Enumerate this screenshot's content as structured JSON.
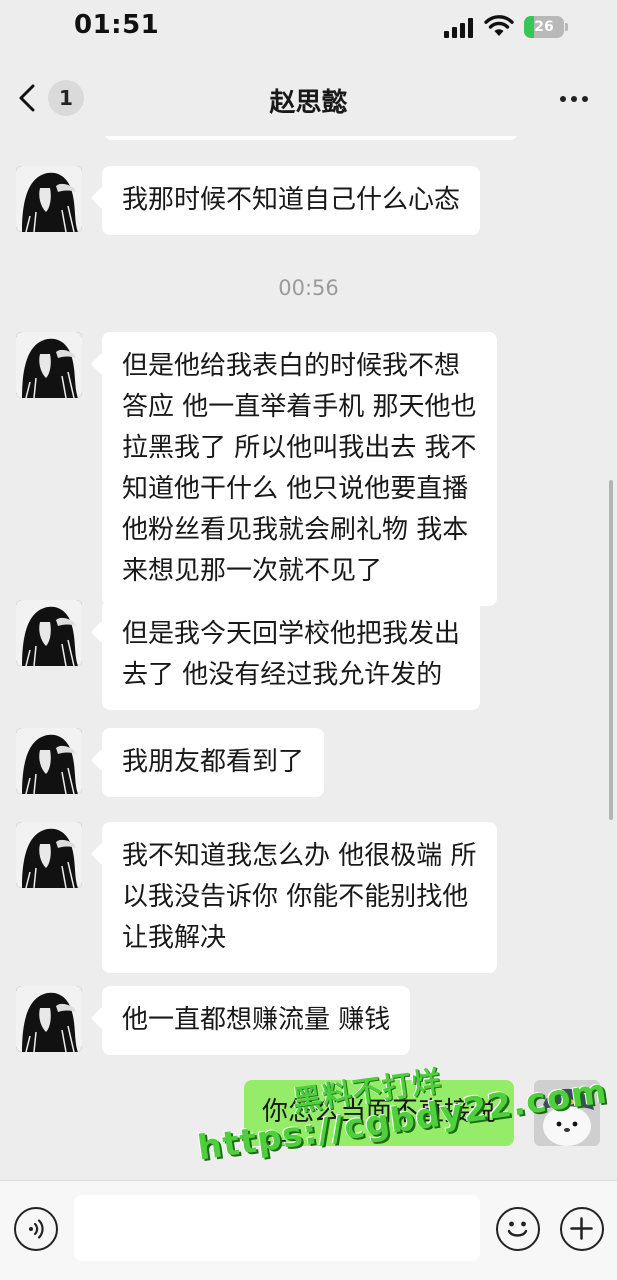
{
  "status_bar": {
    "time": "01:51",
    "battery_level": "26",
    "battery_fill_fraction": 0.26,
    "battery_color": "#34c759",
    "signal_icon": "cellular-signal-icon",
    "wifi_icon": "wifi-icon"
  },
  "nav": {
    "back_icon": "chevron-left-icon",
    "unread_count": "1",
    "title": "赵思懿",
    "more_icon": "more-dots-icon"
  },
  "messages": [
    {
      "sender": "contact",
      "text": "我那时候不知道自己什么心态"
    },
    {
      "type": "timestamp",
      "text": "00:56"
    },
    {
      "sender": "contact",
      "text": "但是他给我表白的时候我不想\n答应 他一直举着手机 那天他也\n拉黑我了 所以他叫我出去 我不\n知道他干什么 他只说他要直播\n他粉丝看见我就会刷礼物 我本\n来想见那一次就不见了"
    },
    {
      "sender": "contact",
      "text": "但是我今天回学校他把我发出\n去了 他没有经过我允许发的"
    },
    {
      "sender": "contact",
      "text": "我朋友都看到了"
    },
    {
      "sender": "contact",
      "text": "我不知道我怎么办 他很极端 所\n以我没告诉你 你能不能别找他\n让我解决"
    },
    {
      "sender": "contact",
      "text": "他一直都想赚流量 赚钱"
    },
    {
      "sender": "me",
      "text": "你怎么当面不直接说呢"
    }
  ],
  "watermark": {
    "line1": "黑料不打烊",
    "line2": "https://cgbdy22.com",
    "color": "#4fcf3c"
  },
  "input_bar": {
    "voice_icon": "voice-input-icon",
    "emoji_icon": "emoji-icon",
    "add_icon": "plus-circle-icon",
    "placeholder": ""
  },
  "colors": {
    "background": "#ededed",
    "my_bubble": "#95ec69",
    "contact_bubble": "#ffffff",
    "timestamp_text": "#9b9b9b"
  }
}
